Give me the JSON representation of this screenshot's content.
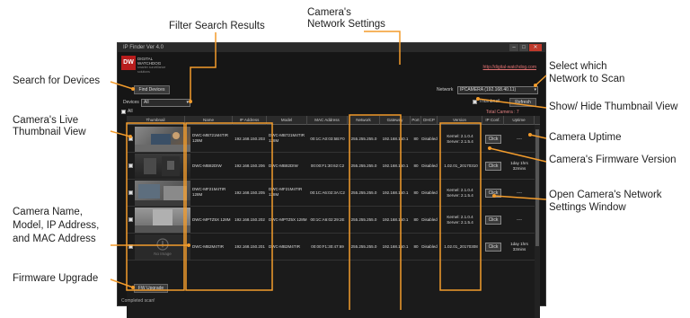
{
  "callouts": {
    "filter_search": "Filter Search Results",
    "network_settings_1": "Camera's",
    "network_settings_2": "Network Settings",
    "search_devices": "Search for Devices",
    "live_thumb_1": "Camera's Live",
    "live_thumb_2": "Thumbnail View",
    "name_model_1": "Camera Name,",
    "name_model_2": "Model, IP Address,",
    "name_model_3": "and MAC Address",
    "firmware_upgrade": "Firmware Upgrade",
    "select_network_1": "Select which",
    "select_network_2": "Network to Scan",
    "show_hide_thumb": "Show/ Hide Thumbnail View",
    "uptime": "Camera Uptime",
    "fw_version": "Camera's Firmware Version",
    "open_settings_1": "Open Camera's Network",
    "open_settings_2": "Settings Window"
  },
  "app": {
    "title": "IP Finder  Ver 4.0",
    "logo_mark": "DW",
    "logo_text": "DIGITAL WATCHDOG",
    "logo_tagline": "smarter surveillance solutions",
    "website": "http://digital-watchdog.com",
    "find_devices": "Find Devices",
    "devices_label": "Devices",
    "devices_value": "All",
    "network_label": "Network",
    "network_value": "IPCAMERA (192.168.40.11)",
    "thumbnail_label": "Thumbnail",
    "refresh": "Refresh",
    "total_cameras": "Total Camera : 7",
    "all_label": "All",
    "fw_upgrade": "FW Upgrade",
    "status": "Completed scan!"
  },
  "columns": [
    "Thumbnail",
    "Name",
    "IP Address",
    "Model",
    "MAC Address",
    "Network",
    "Gateway",
    "Port",
    "DHCP",
    "Version",
    "IP Conf.",
    "Uptime"
  ],
  "rows": [
    {
      "name": "DWC-MB721M4TIR 128M",
      "ip": "192.168.150.203",
      "model": "DWC-MB721M4TIR 128M",
      "mac": "00:1C:A0:03:5B:F0",
      "network": "255.255.255.0",
      "gateway": "192.168.150.1",
      "port": "80",
      "dhcp": "Disabled",
      "version": "Kernel: 2.1.0.4 Server: 2.1.5.4",
      "conf": "Click",
      "uptime": "----"
    },
    {
      "name": "DWC-MB82DIW",
      "ip": "192.168.150.206",
      "model": "DWC-MB82DIW",
      "mac": "00:00:F1:30:62:C2",
      "network": "255.255.255.0",
      "gateway": "192.168.150.1",
      "port": "80",
      "dhcp": "Disabled",
      "version": "1.02.01_20170310",
      "conf": "Click",
      "uptime": "1day 1hrs 32mins"
    },
    {
      "name": "DWC-MF21M4TIR 128M",
      "ip": "192.168.150.205",
      "model": "DWC-MF21M4TIR 128M",
      "mac": "00:1C:A6:02:3A:C2",
      "network": "255.255.255.0",
      "gateway": "192.168.150.1",
      "port": "80",
      "dhcp": "Disabled",
      "version": "Kernel: 2.1.0.4 Server: 2.1.5.4",
      "conf": "Click",
      "uptime": "----"
    },
    {
      "name": "DWC-MPTZ5X 128M",
      "ip": "192.168.150.202",
      "model": "DWC-MPTZ5X 128M",
      "mac": "00:1C:A6:02:29:2E",
      "network": "255.255.255.0",
      "gateway": "192.168.150.1",
      "port": "80",
      "dhcp": "Disabled",
      "version": "Kernel: 2.1.0.4 Server: 2.1.5.4",
      "conf": "Click",
      "uptime": "----"
    },
    {
      "name": "DWC-MB2M4TIR",
      "ip": "192.168.150.201",
      "model": "DWC-MB2M4TIR",
      "mac": "00:00:F1:30:47:69",
      "network": "255.255.255.0",
      "gateway": "192.168.150.1",
      "port": "80",
      "dhcp": "Disabled",
      "version": "1.02.01_20170308",
      "conf": "Click",
      "uptime": "1day 1hrs 33mins"
    }
  ],
  "no_image_label": "No Image",
  "colors": {
    "accent_orange": "#f39c2c",
    "brand_red": "#b81d1d"
  }
}
